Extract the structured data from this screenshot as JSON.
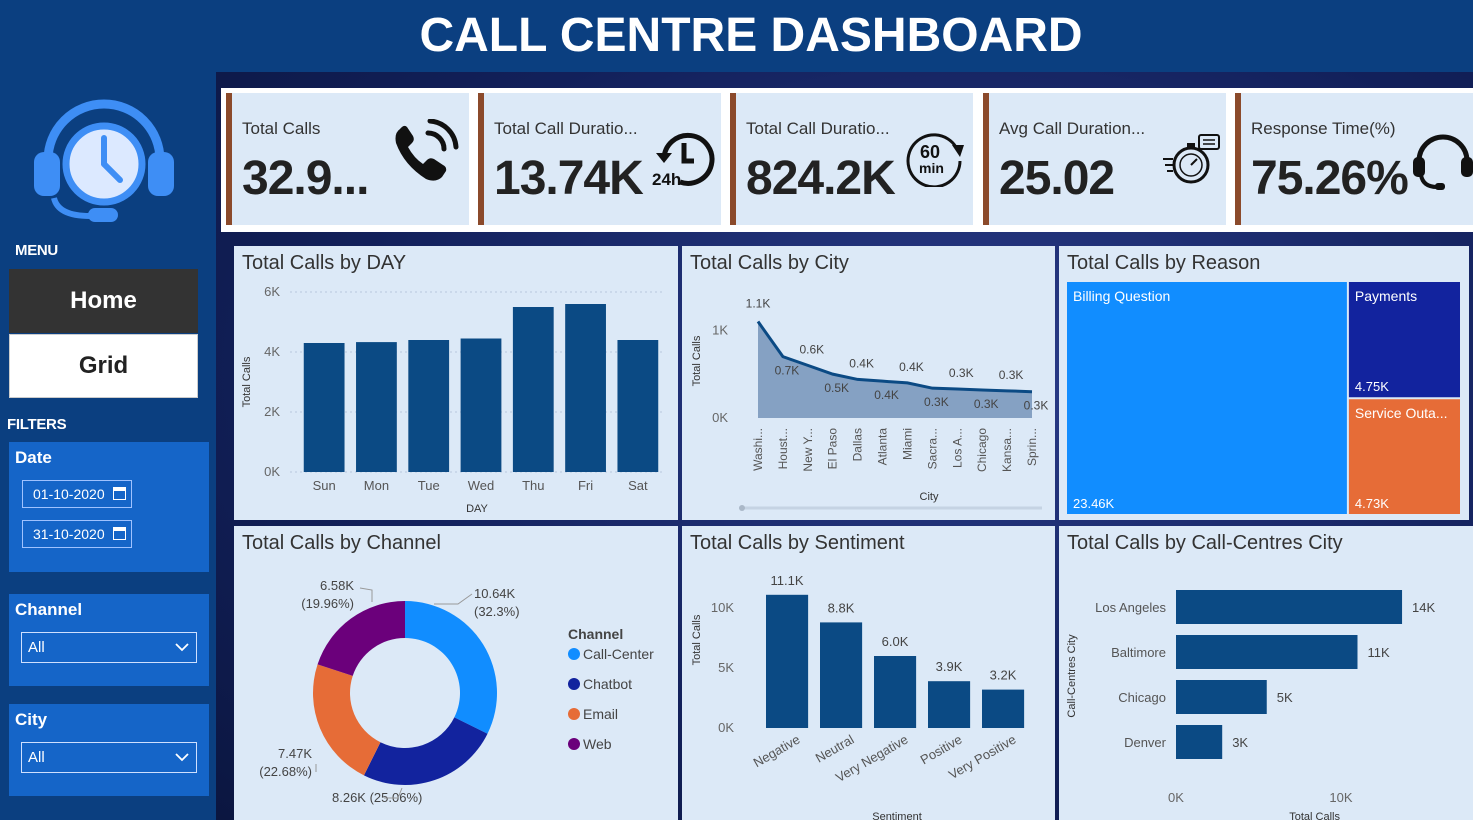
{
  "title": "CALL CENTRE DASHBOARD",
  "sidebar": {
    "menu_heading": "MENU",
    "nav": {
      "home": "Home",
      "grid": "Grid"
    },
    "filters_heading": "FILTERS",
    "date": {
      "label": "Date",
      "start": "01-10-2020",
      "end": "31-10-2020"
    },
    "channel": {
      "label": "Channel",
      "value": "All"
    },
    "city": {
      "label": "City",
      "value": "All"
    }
  },
  "kpis": [
    {
      "label": "Total Calls",
      "value": "32.9...",
      "icon": "phone-ringing-icon"
    },
    {
      "label": "Total Call Duratio...",
      "value": "13.74K",
      "icon": "24h-clock-icon",
      "icon_text": "24h"
    },
    {
      "label": "Total Call Duratio...",
      "value": "824.2K",
      "icon": "60-min-icon",
      "icon_text_top": "60",
      "icon_text_bottom": "min"
    },
    {
      "label": "Avg Call Duration...",
      "value": "25.02",
      "icon": "stopwatch-icon"
    },
    {
      "label": "Response Time(%)",
      "value": "75.26%",
      "icon": "headset-icon"
    }
  ],
  "chart_data": [
    {
      "id": "by_day",
      "type": "bar",
      "title": "Total Calls by DAY",
      "xlabel": "DAY",
      "ylabel": "Total Calls",
      "categories": [
        "Sun",
        "Mon",
        "Tue",
        "Wed",
        "Thu",
        "Fri",
        "Sat"
      ],
      "values": [
        4300,
        4330,
        4400,
        4450,
        5500,
        5600,
        4400
      ],
      "ylim": [
        0,
        6000
      ],
      "yticks": [
        "0K",
        "2K",
        "4K",
        "6K"
      ],
      "color": "#0b4a84"
    },
    {
      "id": "by_city",
      "type": "area",
      "title": "Total Calls by City",
      "xlabel": "City",
      "ylabel": "Total Calls",
      "categories": [
        "Washi...",
        "Houst...",
        "New Y...",
        "El Paso",
        "Dallas",
        "Atlanta",
        "Miami",
        "Sacra...",
        "Los A...",
        "Chicago",
        "Kansa...",
        "Sprin..."
      ],
      "values": [
        1100,
        700,
        600,
        500,
        440,
        420,
        400,
        340,
        330,
        320,
        310,
        300
      ],
      "value_labels": [
        "1.1K",
        "0.7K",
        "0.6K",
        "0.5K",
        "0.4K",
        "0.4K",
        "0.4K",
        "0.3K",
        "0.3K",
        "0.3K",
        "0.3K",
        "0.3K"
      ],
      "ylim": [
        0,
        1300
      ],
      "yticks": [
        "0K",
        "1K"
      ],
      "color": "#0b4a84"
    },
    {
      "id": "by_reason",
      "type": "treemap",
      "title": "Total Calls by Reason",
      "items": [
        {
          "name": "Billing Question",
          "value": 23460,
          "label": "23.46K",
          "color": "#118dff"
        },
        {
          "name": "Payments",
          "value": 4750,
          "label": "4.75K",
          "color": "#12239e"
        },
        {
          "name": "Service Outa...",
          "value": 4730,
          "label": "4.73K",
          "color": "#e66c37"
        }
      ]
    },
    {
      "id": "by_channel",
      "type": "pie",
      "title": "Total Calls by Channel",
      "legend_title": "Channel",
      "slices": [
        {
          "name": "Call-Center",
          "value": 10640,
          "label": "10.64K",
          "pct": "(32.3%)",
          "color": "#118dff"
        },
        {
          "name": "Chatbot",
          "value": 8260,
          "label": "8.26K (25.06%)",
          "pct": "",
          "color": "#12239e"
        },
        {
          "name": "Email",
          "value": 7470,
          "label": "7.47K",
          "pct": "(22.68%)",
          "color": "#e66c37"
        },
        {
          "name": "Web",
          "value": 6580,
          "label": "6.58K",
          "pct": "(19.96%)",
          "color": "#6b007b"
        }
      ]
    },
    {
      "id": "by_sentiment",
      "type": "bar",
      "title": "Total Calls by Sentiment",
      "xlabel": "Sentiment",
      "ylabel": "Total Calls",
      "categories": [
        "Negative",
        "Neutral",
        "Very Negative",
        "Positive",
        "Very Positive"
      ],
      "values": [
        11100,
        8800,
        6000,
        3900,
        3200
      ],
      "value_labels": [
        "11.1K",
        "8.8K",
        "6.0K",
        "3.9K",
        "3.2K"
      ],
      "ylim": [
        0,
        12000
      ],
      "yticks": [
        "0K",
        "5K",
        "10K"
      ],
      "color": "#0b4a84"
    },
    {
      "id": "by_cc_city",
      "type": "bar",
      "orientation": "horizontal",
      "title": "Total Calls by Call-Centres City",
      "xlabel": "Total Calls",
      "ylabel": "Call-Centres City",
      "categories": [
        "Los Angeles",
        "Baltimore",
        "Chicago",
        "Denver"
      ],
      "values": [
        13700,
        11000,
        5500,
        2800
      ],
      "value_labels": [
        "14K",
        "11K",
        "5K",
        "3K"
      ],
      "xlim": [
        0,
        10000
      ],
      "xticks": [
        "0K",
        "10K"
      ],
      "color": "#0b4a84"
    }
  ]
}
